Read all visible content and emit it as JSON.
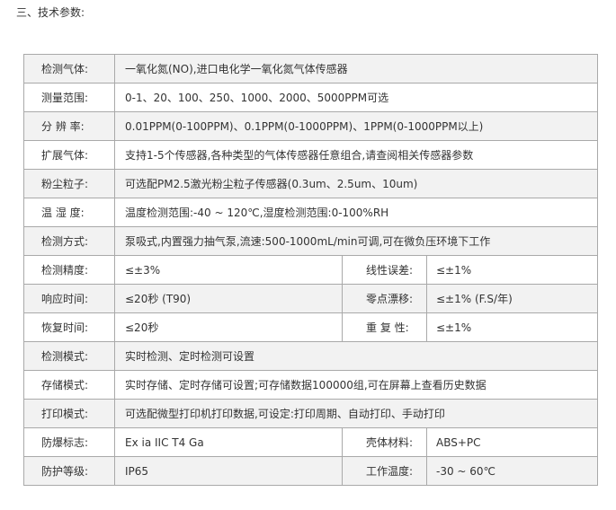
{
  "heading": "三、技术参数:",
  "rows": [
    {
      "label": "检测气体:",
      "value": "一氧化氮(NO),进口电化学一氧化氮气体传感器"
    },
    {
      "label": "测量范围:",
      "value": "0-1、20、100、250、1000、2000、5000PPM可选"
    },
    {
      "label": "分 辨 率:",
      "value": "0.01PPM(0-100PPM)、0.1PPM(0-1000PPM)、1PPM(0-1000PPM以上)"
    },
    {
      "label": "扩展气体:",
      "value": "支持1-5个传感器,各种类型的气体传感器任意组合,请查阅相关传感器参数"
    },
    {
      "label": "粉尘粒子:",
      "value": "可选配PM2.5激光粉尘粒子传感器(0.3um、2.5um、10um)"
    },
    {
      "label": "温 湿 度:",
      "value": "温度检测范围:-40 ~ 120℃,湿度检测范围:0-100%RH"
    },
    {
      "label": "检测方式:",
      "value": "泵吸式,内置强力抽气泵,流速:500-1000mL/min可调,可在微负压环境下工作"
    },
    {
      "label": "检测精度:",
      "value": "≤±3%",
      "label2": "线性误差:",
      "value2": "≤±1%"
    },
    {
      "label": "响应时间:",
      "value": "≤20秒 (T90)",
      "label2": "零点漂移:",
      "value2": "≤±1% (F.S/年)"
    },
    {
      "label": "恢复时间:",
      "value": "≤20秒",
      "label2": "重 复 性:",
      "value2": "≤±1%"
    },
    {
      "label": "检测模式:",
      "value": "实时检测、定时检测可设置"
    },
    {
      "label": "存储模式:",
      "value": "实时存储、定时存储可设置;可存储数据100000组,可在屏幕上查看历史数据"
    },
    {
      "label": "打印模式:",
      "value": "可选配微型打印机打印数据,可设定:打印周期、自动打印、手动打印"
    },
    {
      "label": "防爆标志:",
      "value": "Ex ia IIC T4 Ga",
      "label2": "壳体材料:",
      "value2": "ABS+PC"
    },
    {
      "label": "防护等级:",
      "value": "IP65",
      "label2": "工作温度:",
      "value2": "-30 ~ 60℃"
    }
  ]
}
